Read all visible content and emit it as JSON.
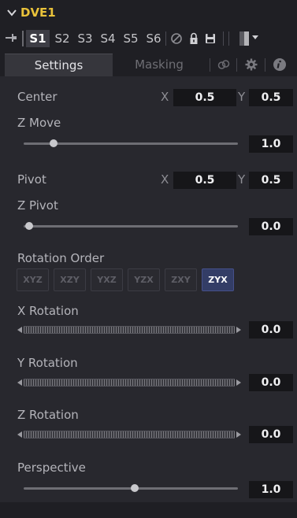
{
  "header": {
    "title": "DVE1",
    "collapse_icon": "chevron-down-icon"
  },
  "toolbar": {
    "pin_icon": "pin-icon",
    "slots": [
      "S1",
      "S2",
      "S3",
      "S4",
      "S5",
      "S6"
    ],
    "active_slot": "S1",
    "icons": [
      "reset-icon",
      "lock-icon",
      "save-icon"
    ],
    "color_swatch_icon": "color-swatch-dropdown-icon"
  },
  "tabs": {
    "settings": "Settings",
    "masking": "Masking",
    "icons": [
      "link-icon",
      "gear-icon",
      "info-icon"
    ]
  },
  "colors": {
    "title": "#e9c23a",
    "active_rotation": "#333d66",
    "panel_bg": "#28282e",
    "field_bg": "#161619"
  },
  "controls": {
    "center": {
      "label": "Center",
      "x_label": "X",
      "x": "0.5",
      "y_label": "Y",
      "y": "0.5"
    },
    "z_move": {
      "label": "Z Move",
      "value": "1.0",
      "fraction": 0.12
    },
    "pivot": {
      "label": "Pivot",
      "x_label": "X",
      "x": "0.5",
      "y_label": "Y",
      "y": "0.5"
    },
    "z_pivot": {
      "label": "Z Pivot",
      "value": "0.0",
      "fraction": 0.0
    },
    "rotation_order": {
      "label": "Rotation Order",
      "options": [
        "XYZ",
        "XZY",
        "YXZ",
        "YZX",
        "ZXY",
        "ZYX"
      ],
      "selected": "ZYX"
    },
    "x_rotation": {
      "label": "X Rotation",
      "value": "0.0"
    },
    "y_rotation": {
      "label": "Y Rotation",
      "value": "0.0"
    },
    "z_rotation": {
      "label": "Z Rotation",
      "value": "0.0"
    },
    "perspective": {
      "label": "Perspective",
      "value": "1.0",
      "fraction": 0.5
    }
  }
}
